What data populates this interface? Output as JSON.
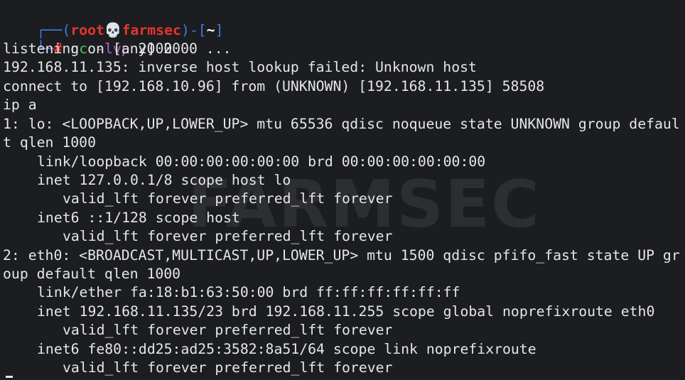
{
  "prompt": {
    "corner_top": "┌──(",
    "user": "root",
    "skull": "💀",
    "host": "farmsec",
    "mid": ")-[",
    "dir": "~",
    "close": "]",
    "corner_bottom": "└─",
    "hash": "#",
    "cmd_name": "nc",
    "cmd_flags": "-lvp",
    "cmd_port": "2000"
  },
  "watermark": "FARMSEC",
  "lines": [
    "listening on [any] 2000 ...",
    "192.168.11.135: inverse host lookup failed: Unknown host",
    "connect to [192.168.10.96] from (UNKNOWN) [192.168.11.135] 58508",
    "ip a",
    "1: lo: <LOOPBACK,UP,LOWER_UP> mtu 65536 qdisc noqueue state UNKNOWN group defaul",
    "t qlen 1000",
    "link/loopback 00:00:00:00:00:00 brd 00:00:00:00:00:00",
    "inet 127.0.0.1/8 scope host lo",
    "valid_lft forever preferred_lft forever",
    "inet6 ::1/128 scope host",
    "valid_lft forever preferred_lft forever",
    "2: eth0: <BROADCAST,MULTICAST,UP,LOWER_UP> mtu 1500 qdisc pfifo_fast state UP gr",
    "oup default qlen 1000",
    "link/ether fa:18:b1:63:50:00 brd ff:ff:ff:ff:ff:ff",
    "inet 192.168.11.135/23 brd 192.168.11.255 scope global noprefixroute eth0",
    "valid_lft forever preferred_lft forever",
    "inet6 fe80::dd25:ad25:3582:8a51/64 scope link noprefixroute",
    "valid_lft forever preferred_lft forever"
  ]
}
